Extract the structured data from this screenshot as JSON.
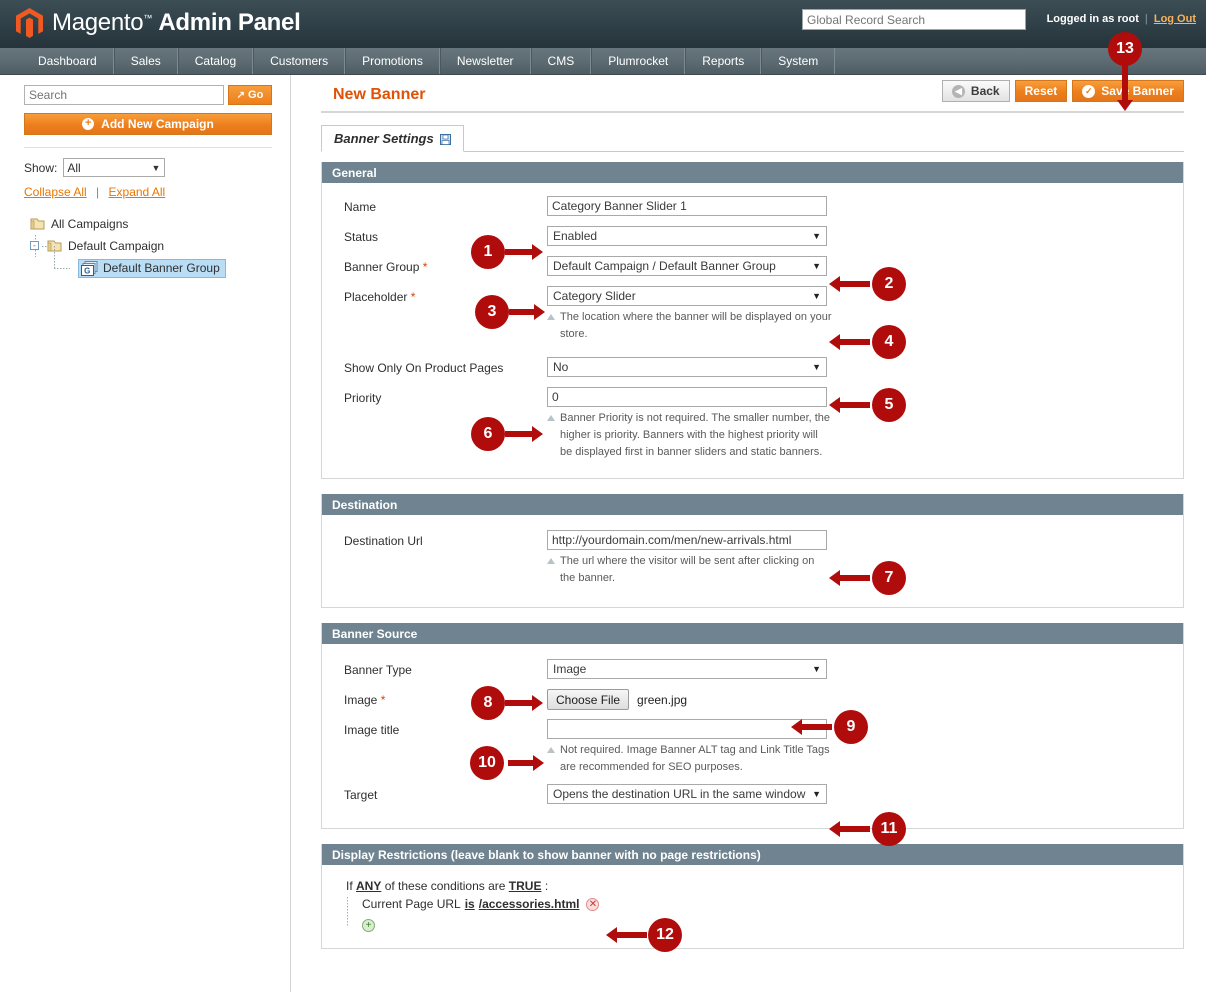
{
  "header": {
    "brand_name": "Magento",
    "brand_tm": "™",
    "brand_suffix": "Admin Panel",
    "search_placeholder": "Global Record Search",
    "search_value": "",
    "logged_in_text": "Logged in as root",
    "separator": "|",
    "logout_label": "Log Out",
    "accent_color": "#ea7601",
    "logo_color": "#f05a22"
  },
  "nav": {
    "items": [
      {
        "label": "Dashboard"
      },
      {
        "label": "Sales"
      },
      {
        "label": "Catalog"
      },
      {
        "label": "Customers"
      },
      {
        "label": "Promotions"
      },
      {
        "label": "Newsletter"
      },
      {
        "label": "CMS"
      },
      {
        "label": "Plumrocket"
      },
      {
        "label": "Reports"
      },
      {
        "label": "System"
      }
    ]
  },
  "sidebar": {
    "search_placeholder": "Search",
    "search_value": "",
    "go_label": "Go",
    "go_icon": "external-link-icon",
    "add_campaign_label": "Add New Campaign",
    "add_icon": "plus-circle-icon",
    "show_label": "Show:",
    "show_value": "All",
    "collapse_all": "Collapse All",
    "expand_all": "Expand All",
    "links_separator": "|",
    "tree": [
      {
        "label": "All Campaigns",
        "level": 1,
        "icon": "folder-icon",
        "selected": false
      },
      {
        "label": "Default Campaign",
        "level": 2,
        "icon": "folder-icon",
        "selected": false,
        "expander": "-"
      },
      {
        "label": "Default Banner Group",
        "level": 3,
        "icon": "banner-group-icon",
        "selected": true
      }
    ]
  },
  "page": {
    "title": "New Banner",
    "buttons": [
      {
        "label": "Back",
        "style": "grey",
        "icon": "back-arrow-icon"
      },
      {
        "label": "Reset",
        "style": "orange",
        "icon": ""
      },
      {
        "label": "Save Banner",
        "style": "orange",
        "icon": "check-circle-icon"
      }
    ],
    "tabs": [
      {
        "label": "Banner Settings",
        "icon": "save-floppy-icon",
        "active": true
      }
    ]
  },
  "sections": {
    "general": {
      "title": "General",
      "fields": [
        {
          "label": "Name",
          "required": false,
          "control": "input",
          "value": "Category Banner Slider 1",
          "note": ""
        },
        {
          "label": "Status",
          "required": false,
          "control": "select",
          "value": "Enabled",
          "note": ""
        },
        {
          "label": "Banner Group",
          "required": true,
          "control": "select",
          "value": "Default Campaign / Default Banner Group",
          "note": ""
        },
        {
          "label": "Placeholder",
          "required": true,
          "control": "select",
          "value": "Category Slider",
          "note": "The location where the banner will be displayed on your store."
        },
        {
          "label": "Show Only On Product Pages",
          "required": false,
          "control": "select",
          "value": "No",
          "note": ""
        },
        {
          "label": "Priority",
          "required": false,
          "control": "input",
          "value": "0",
          "note": "Banner Priority is not required. The smaller number, the higher is priority. Banners with the highest priority will be displayed first in banner sliders and static banners."
        }
      ]
    },
    "destination": {
      "title": "Destination",
      "fields": [
        {
          "label": "Destination Url",
          "required": false,
          "control": "input",
          "value": "http://yourdomain.com/men/new-arrivals.html",
          "note": "The url where the visitor will be sent after clicking on the banner."
        }
      ]
    },
    "banner_source": {
      "title": "Banner Source",
      "fields": [
        {
          "label": "Banner Type",
          "required": false,
          "control": "select",
          "value": "Image",
          "note": ""
        },
        {
          "label": "Image",
          "required": true,
          "control": "file",
          "value": "green.jpg",
          "button_label": "Choose File",
          "note": ""
        },
        {
          "label": "Image title",
          "required": false,
          "control": "input",
          "value": "",
          "note": "Not required. Image Banner ALT tag and Link Title Tags are recommended for SEO purposes."
        },
        {
          "label": "Target",
          "required": false,
          "control": "select",
          "value": "Opens the destination URL in the same window",
          "note": ""
        }
      ]
    },
    "display_restrictions": {
      "title": "Display Restrictions (leave blank to show banner with no page restrictions)",
      "if_prefix": "If",
      "any_label": "ANY",
      "mid_text": "of these conditions are",
      "true_label": "TRUE",
      "colon": ":",
      "condition": {
        "attribute": "Current Page URL",
        "operator": "is",
        "value": "/accessories.html",
        "delete_icon": "remove-circle-icon"
      },
      "add_icon": "add-circle-icon"
    }
  },
  "callouts": {
    "badge_color": "#b10c0c",
    "items": [
      {
        "number": "1",
        "target": "name-input"
      },
      {
        "number": "2",
        "target": "status-select"
      },
      {
        "number": "3",
        "target": "banner-group-select"
      },
      {
        "number": "4",
        "target": "placeholder-select"
      },
      {
        "number": "5",
        "target": "show-only-product-pages-select"
      },
      {
        "number": "6",
        "target": "priority-input"
      },
      {
        "number": "7",
        "target": "destination-url-input"
      },
      {
        "number": "8",
        "target": "banner-type-select"
      },
      {
        "number": "9",
        "target": "image-file-field"
      },
      {
        "number": "10",
        "target": "image-title-input"
      },
      {
        "number": "11",
        "target": "target-select"
      },
      {
        "number": "12",
        "target": "condition-row"
      },
      {
        "number": "13",
        "target": "save-banner-button"
      }
    ]
  }
}
